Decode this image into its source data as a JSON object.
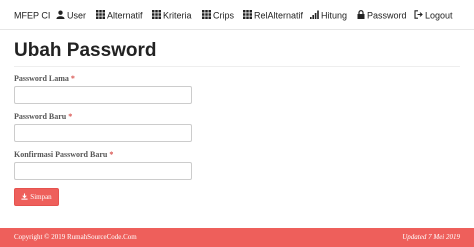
{
  "nav": {
    "brand": "MFEP CI",
    "items": [
      {
        "label": "User",
        "icon": "user-icon"
      },
      {
        "label": "Alternatif",
        "icon": "th-icon"
      },
      {
        "label": "Kriteria",
        "icon": "th-icon"
      },
      {
        "label": "Crips",
        "icon": "th-icon"
      },
      {
        "label": "RelAlternatif",
        "icon": "th-icon"
      },
      {
        "label": "Hitung",
        "icon": "signal-icon"
      },
      {
        "label": "Password",
        "icon": "lock-icon"
      },
      {
        "label": "Logout",
        "icon": "logout-icon"
      }
    ]
  },
  "page": {
    "title": "Ubah Password"
  },
  "form": {
    "old_password": {
      "label": "Password Lama",
      "required": "*",
      "value": ""
    },
    "new_password": {
      "label": "Password Baru",
      "required": "*",
      "value": ""
    },
    "confirm_password": {
      "label": "Konfirmasi Password Baru",
      "required": "*",
      "value": ""
    },
    "save_label": "Simpan"
  },
  "footer": {
    "copyright": "Copyright © 2019 RumahSourceCode.Com",
    "updated": "Updated 7 Mei 2019"
  },
  "colors": {
    "accent": "#ee5f5b"
  }
}
